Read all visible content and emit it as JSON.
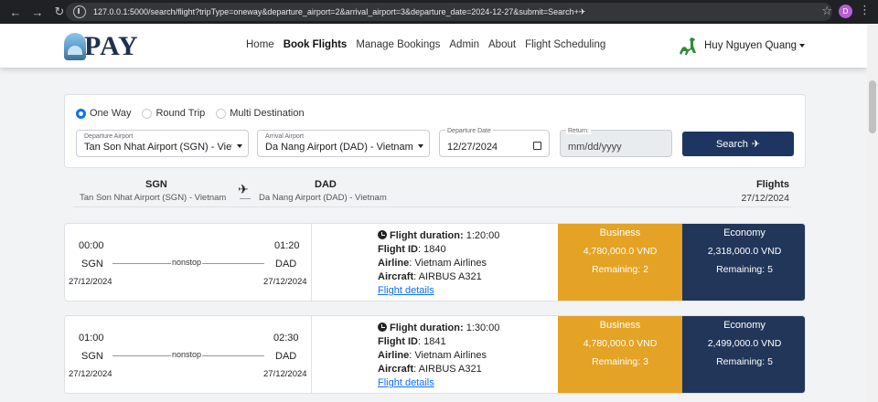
{
  "browser": {
    "url": "127.0.0.1:5000/search/flight?tripType=oneway&departure_airport=2&arrival_airport=3&departure_date=2024-12-27&submit=Search+✈",
    "profile_initial": "D"
  },
  "navbar": {
    "logo_text": "PAY",
    "links": [
      "Home",
      "Book Flights",
      "Manage Bookings",
      "Admin",
      "About",
      "Flight Scheduling"
    ],
    "active_link": "Book Flights",
    "user_name": "Huy Nguyen Quang"
  },
  "search": {
    "trip_types": [
      "One Way",
      "Round Trip",
      "Multi Destination"
    ],
    "selected_trip_type": "One Way",
    "departure_label": "Departure Airport",
    "departure_value": "Tan Son Nhat Airport (SGN) - Vietnam",
    "arrival_label": "Arrival Airport",
    "arrival_value": "Da Nang Airport (DAD) - Vietnam",
    "date_label": "Departure Date",
    "date_value": "12/27/2024",
    "return_label": "Return:",
    "return_placeholder": "mm/dd/yyyy",
    "submit_label": "Search"
  },
  "route": {
    "from_code": "SGN",
    "from_name": "Tan Son Nhat Airport (SGN) - Vietnam",
    "to_code": "DAD",
    "to_name": "Da Nang Airport (DAD) - Vietnam",
    "flights_label": "Flights",
    "date": "27/12/2024"
  },
  "flights": [
    {
      "depart_time": "00:00",
      "arrive_time": "01:20",
      "from": "SGN",
      "to": "DAD",
      "stops": "nonstop",
      "depart_date": "27/12/2024",
      "arrive_date": "27/12/2024",
      "duration_label": "Flight duration:",
      "duration": "1:20:00",
      "id_label": "Flight ID",
      "id": "1840",
      "airline_label": "Airline",
      "airline": "Vietnam Airlines",
      "aircraft_label": "Aircraft",
      "aircraft": "AIRBUS A321",
      "details_link": "Flight details",
      "business": {
        "label": "Business",
        "price": "4,780,000.0 VND",
        "remaining": "Remaining: 2"
      },
      "economy": {
        "label": "Economy",
        "price": "2,318,000.0 VND",
        "remaining": "Remaining: 5"
      }
    },
    {
      "depart_time": "01:00",
      "arrive_time": "02:30",
      "from": "SGN",
      "to": "DAD",
      "stops": "nonstop",
      "depart_date": "27/12/2024",
      "arrive_date": "27/12/2024",
      "duration_label": "Flight duration:",
      "duration": "1:30:00",
      "id_label": "Flight ID",
      "id": "1841",
      "airline_label": "Airline",
      "airline": "Vietnam Airlines",
      "aircraft_label": "Aircraft",
      "aircraft": "AIRBUS A321",
      "details_link": "Flight details",
      "business": {
        "label": "Business",
        "price": "4,780,000.0 VND",
        "remaining": "Remaining: 3"
      },
      "economy": {
        "label": "Economy",
        "price": "2,499,000.0 VND",
        "remaining": "Remaining: 5"
      }
    }
  ],
  "colors": {
    "accent": "#0d6efd",
    "navy": "#213659",
    "business": "#e4a325"
  }
}
